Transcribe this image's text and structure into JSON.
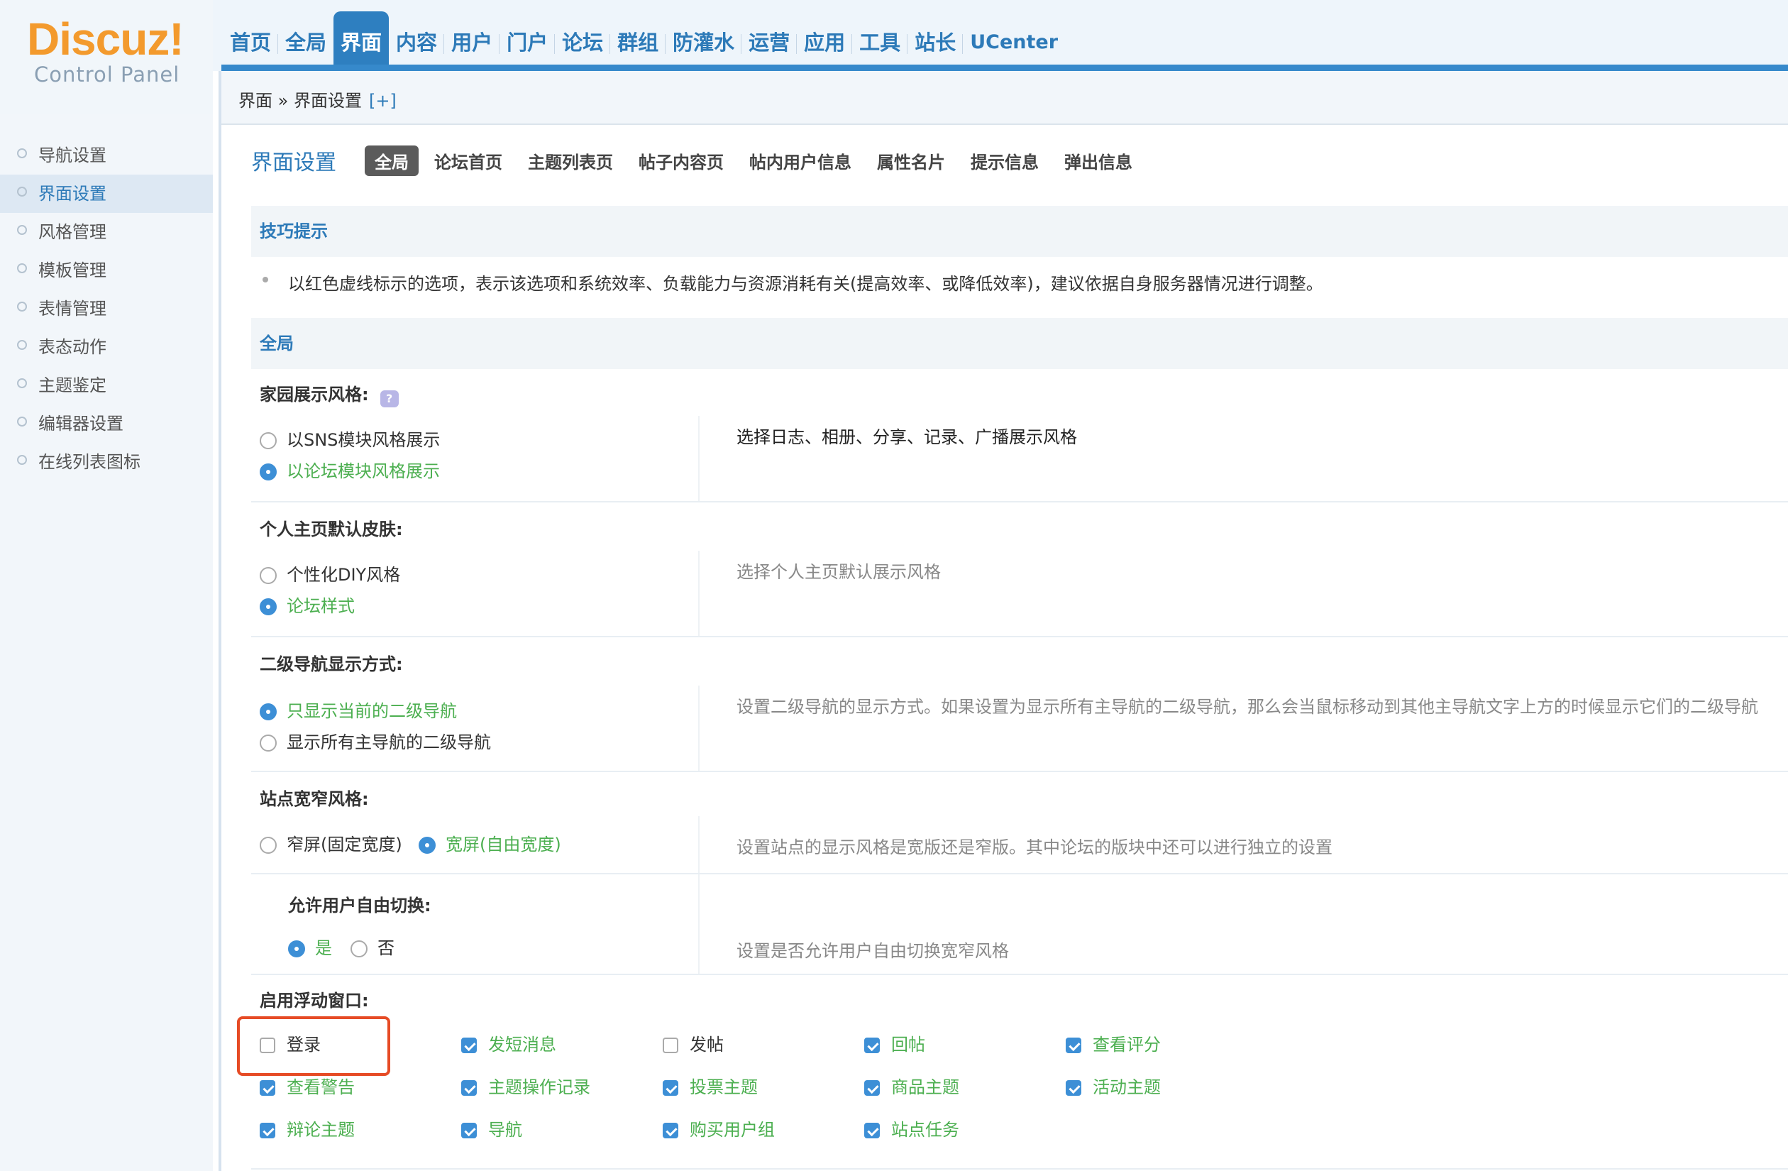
{
  "logo": {
    "brand": "Discuz!",
    "subtitle": "Control Panel"
  },
  "nav": [
    "首页",
    "全局",
    "界面",
    "内容",
    "用户",
    "门户",
    "论坛",
    "群组",
    "防灌水",
    "运营",
    "应用",
    "工具",
    "站长",
    "UCenter"
  ],
  "nav_active": "界面",
  "sidebar": [
    "导航设置",
    "界面设置",
    "风格管理",
    "模板管理",
    "表情管理",
    "表态动作",
    "主题鉴定",
    "编辑器设置",
    "在线列表图标"
  ],
  "sidebar_active": "界面设置",
  "breadcrumb": {
    "text": "界面 » 界面设置",
    "plus": "[+]"
  },
  "page_title": "界面设置",
  "subtabs": [
    "全局",
    "论坛首页",
    "主题列表页",
    "帖子内容页",
    "帖内用户信息",
    "属性名片",
    "提示信息",
    "弹出信息"
  ],
  "subtab_active": "全局",
  "tips": {
    "heading": "技巧提示",
    "text": "以红色虚线标示的选项，表示该选项和系统效率、负载能力与资源消耗有关(提高效率、或降低效率)，建议依据自身服务器情况进行调整。"
  },
  "global_heading": "全局",
  "settings": {
    "home_style": {
      "label": "家园展示风格:",
      "help_icon": "?",
      "opt1": "以SNS模块风格展示",
      "opt2": "以论坛模块风格展示",
      "selected": 2,
      "desc": "选择日志、相册、分享、记录、广播展示风格"
    },
    "skin": {
      "label": "个人主页默认皮肤:",
      "opt1": "个性化DIY风格",
      "opt2": "论坛样式",
      "selected": 2,
      "desc": "选择个人主页默认展示风格"
    },
    "subnav": {
      "label": "二级导航显示方式:",
      "opt1": "只显示当前的二级导航",
      "opt2": "显示所有主导航的二级导航",
      "selected": 1,
      "desc": "设置二级导航的显示方式。如果设置为显示所有主导航的二级导航，那么会当鼠标移动到其他主导航文字上方的时候显示它们的二级导航"
    },
    "width": {
      "label": "站点宽窄风格:",
      "opt1": "窄屏(固定宽度)",
      "opt2": "宽屏(自由宽度)",
      "selected": 2,
      "desc": "设置站点的显示风格是宽版还是窄版。其中论坛的版块中还可以进行独立的设置"
    },
    "switch": {
      "label": "允许用户自由切换:",
      "opt1": "是",
      "opt2": "否",
      "selected": 1,
      "desc": "设置是否允许用户自由切换宽窄风格"
    },
    "float": {
      "label": "启用浮动窗口:",
      "items": [
        {
          "label": "登录",
          "checked": false
        },
        {
          "label": "发短消息",
          "checked": true
        },
        {
          "label": "发帖",
          "checked": false
        },
        {
          "label": "回帖",
          "checked": true
        },
        {
          "label": "查看评分",
          "checked": true
        },
        {
          "label": "查看警告",
          "checked": true
        },
        {
          "label": "主题操作记录",
          "checked": true
        },
        {
          "label": "投票主题",
          "checked": true
        },
        {
          "label": "商品主题",
          "checked": true
        },
        {
          "label": "活动主题",
          "checked": true
        },
        {
          "label": "辩论主题",
          "checked": true
        },
        {
          "label": "导航",
          "checked": true
        },
        {
          "label": "购买用户组",
          "checked": true
        },
        {
          "label": "站点任务",
          "checked": true
        }
      ]
    }
  }
}
